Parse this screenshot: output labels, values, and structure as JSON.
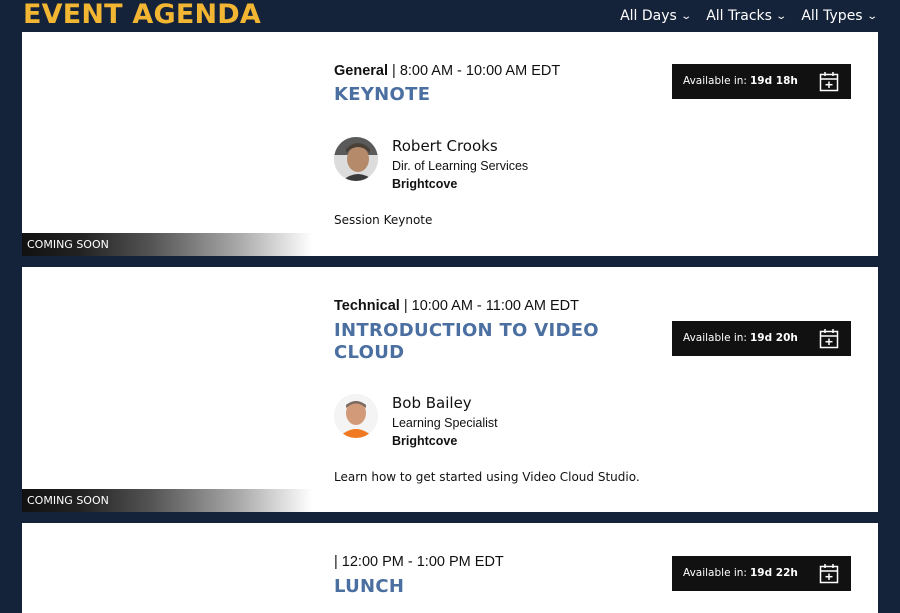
{
  "header": {
    "title": "EVENT AGENDA",
    "filters": [
      {
        "label": "All Days"
      },
      {
        "label": "All Tracks"
      },
      {
        "label": "All Types"
      }
    ]
  },
  "sessions": [
    {
      "track": "General",
      "time": "8:00 AM - 10:00 AM EDT",
      "title": "KEYNOTE",
      "speaker": {
        "name": "Robert Crooks",
        "role": "Dir. of Learning Services",
        "org": "Brightcove"
      },
      "description": "Session Keynote",
      "badge": "COMING SOON",
      "available_label": "Available in:",
      "available_value": "19d 18h"
    },
    {
      "track": "Technical",
      "time": "10:00 AM - 11:00 AM EDT",
      "title": "INTRODUCTION TO VIDEO CLOUD",
      "speaker": {
        "name": "Bob Bailey",
        "role": "Learning Specialist",
        "org": "Brightcove"
      },
      "description": "Learn how to get started using Video Cloud Studio.",
      "badge": "COMING SOON",
      "available_label": "Available in:",
      "available_value": "19d 20h"
    },
    {
      "track": "",
      "time": "12:00 PM - 1:00 PM EDT",
      "title": "LUNCH",
      "available_label": "Available in:",
      "available_value": "19d 22h"
    }
  ],
  "icons": {
    "chevron": "chevron-down-icon",
    "calendar": "calendar-add-icon"
  }
}
